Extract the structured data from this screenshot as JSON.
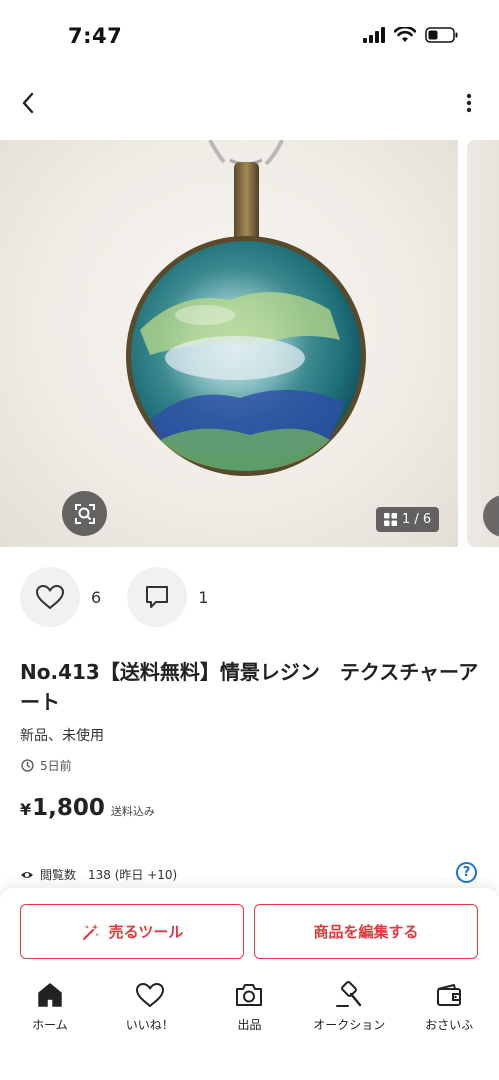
{
  "status_bar": {
    "time": "7:47"
  },
  "gallery": {
    "counter": "1 / 6"
  },
  "actions": {
    "likes_count": "6",
    "comments_count": "1"
  },
  "item": {
    "title": "No.413【送料無料】情景レジン　テクスチャーアート",
    "condition": "新品、未使用",
    "posted": "5日前",
    "price_currency": "¥",
    "price_value": "1,800",
    "price_note": "送料込み",
    "views_label": "閲覧数",
    "views_count": "138 (昨日 +10)"
  },
  "buttons": {
    "sell_tool": "売るツール",
    "edit_item": "商品を編集する"
  },
  "tabs": [
    {
      "label": "ホーム",
      "icon": "home-icon"
    },
    {
      "label": "いいね！",
      "icon": "heart-icon"
    },
    {
      "label": "出品",
      "icon": "camera-icon"
    },
    {
      "label": "オークション",
      "icon": "auction-hammer-icon"
    },
    {
      "label": "おさいふ",
      "icon": "wallet-icon"
    }
  ],
  "colors": {
    "accent": "#e4383c",
    "help": "#1a73d9"
  }
}
